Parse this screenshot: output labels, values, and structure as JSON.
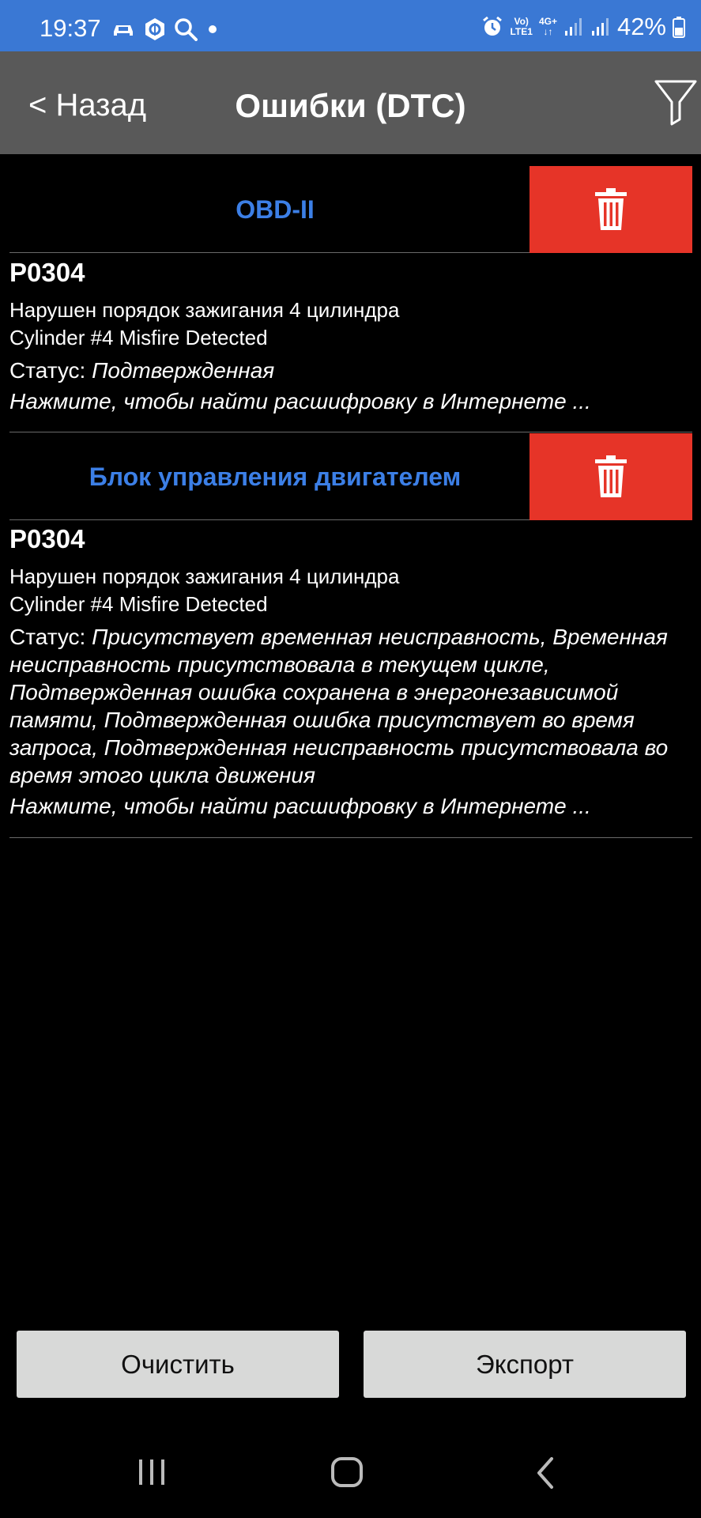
{
  "status_bar": {
    "time": "19:37",
    "battery": "42%",
    "network_label_top": "Vo)",
    "network_label_bottom": "LTE1",
    "network_type": "4G+",
    "icons_left": [
      "car-icon",
      "shield-icon",
      "search-icon",
      "dot-icon"
    ],
    "icons_right": [
      "alarm-icon",
      "signal-icon",
      "signal-icon",
      "battery-icon"
    ]
  },
  "nav": {
    "back_label": "< Назад",
    "title": "Ошибки (DTC)",
    "filter_icon": "filter-icon"
  },
  "sections": [
    {
      "title": "OBD-II",
      "entry": {
        "code": "P0304",
        "desc_ru": "Нарушен порядок зажигания 4 цилиндра",
        "desc_en": "Cylinder #4 Misfire Detected",
        "status_label": "Статус: ",
        "status_value": "Подтвержденная",
        "link": "Нажмите, чтобы найти расшифровку в Интернете ..."
      }
    },
    {
      "title": "Блок управления двигателем",
      "entry": {
        "code": "P0304",
        "desc_ru": "Нарушен порядок зажигания 4 цилиндра",
        "desc_en": "Cylinder #4 Misfire Detected",
        "status_label": "Статус: ",
        "status_value": "Присутствует временная неисправность, Временная неисправность присутствовала в текущем цикле, Подтвержденная ошибка сохранена в энергонезависимой памяти, Подтвержденная ошибка присутствует во время запроса, Подтвержденная неисправность присутствовала во время этого цикла движения",
        "link": "Нажмите, чтобы найти расшифровку в Интернете ..."
      }
    }
  ],
  "buttons": {
    "clear": "Очистить",
    "export": "Экспорт"
  },
  "colors": {
    "status_bar": "#3a78d4",
    "nav_bar": "#595959",
    "accent_title": "#3c7fe6",
    "delete": "#e63428",
    "button_bg": "#d8d9d8"
  }
}
